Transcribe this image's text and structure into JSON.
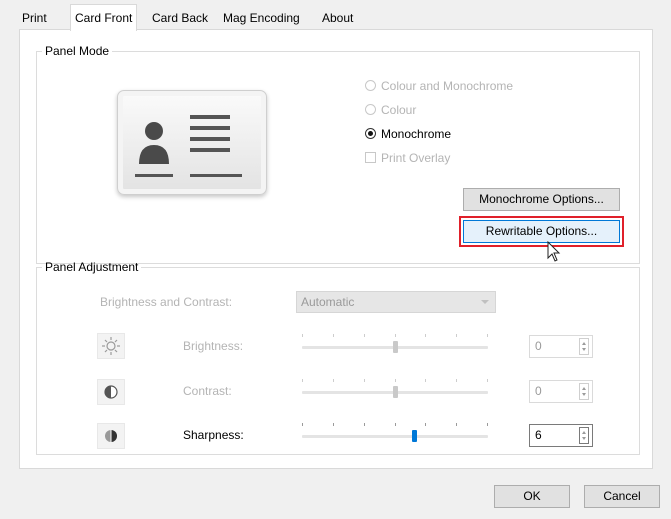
{
  "tabs": [
    {
      "label": "Print",
      "active": false
    },
    {
      "label": "Card Front",
      "active": true
    },
    {
      "label": "Card Back",
      "active": false
    },
    {
      "label": "Mag Encoding",
      "active": false
    },
    {
      "label": "About",
      "active": false
    }
  ],
  "panel_mode": {
    "legend": "Panel Mode",
    "card_icon": "id-card-icon",
    "options": [
      {
        "label": "Colour and Monochrome",
        "selected": false,
        "enabled": false
      },
      {
        "label": "Colour",
        "selected": false,
        "enabled": false
      },
      {
        "label": "Monochrome",
        "selected": true,
        "enabled": true
      }
    ],
    "print_overlay": {
      "label": "Print Overlay",
      "checked": false,
      "enabled": false
    },
    "monochrome_options_label": "Monochrome Options...",
    "rewritable_options_label": "Rewritable Options..."
  },
  "panel_adjustment": {
    "legend": "Panel Adjustment",
    "brightness_contrast_label": "Brightness and Contrast:",
    "brightness_contrast_value": "Automatic",
    "rows": [
      {
        "icon": "brightness-icon",
        "label": "Brightness:",
        "value": "0",
        "enabled": false,
        "level": 0.5
      },
      {
        "icon": "contrast-icon",
        "label": "Contrast:",
        "value": "0",
        "enabled": false,
        "level": 0.5
      },
      {
        "icon": "sharpness-icon",
        "label": "Sharpness:",
        "value": "6",
        "enabled": true,
        "level": 0.6
      }
    ]
  },
  "footer": {
    "ok_label": "OK",
    "cancel_label": "Cancel"
  },
  "colors": {
    "highlight": "#e0202a",
    "accent": "#0078d7",
    "disabled_text": "#b4b4b4"
  }
}
